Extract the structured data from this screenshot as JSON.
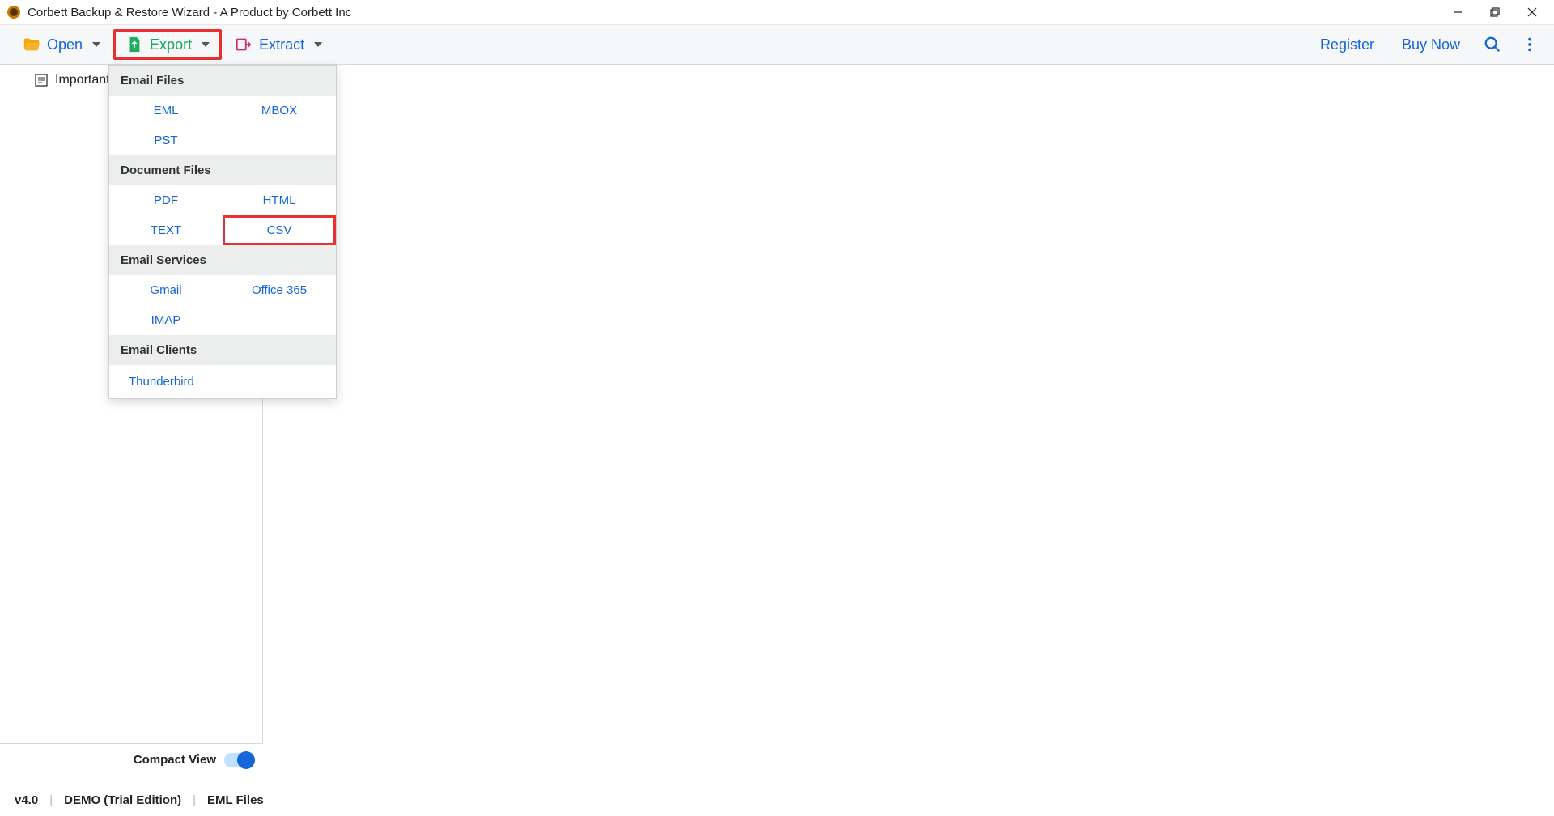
{
  "titlebar": {
    "title": "Corbett Backup & Restore Wizard - A Product by Corbett Inc"
  },
  "toolbar": {
    "open": "Open",
    "export": "Export",
    "extract": "Extract",
    "register": "Register",
    "buy_now": "Buy Now"
  },
  "sidebar": {
    "tree_item": "Important I"
  },
  "compact_view": {
    "label": "Compact View"
  },
  "statusbar": {
    "version": "v4.0",
    "edition": "DEMO (Trial Edition)",
    "filetype": "EML Files"
  },
  "dropdown": {
    "sections": {
      "email_files": {
        "title": "Email Files",
        "items": [
          "EML",
          "MBOX",
          "PST"
        ]
      },
      "document_files": {
        "title": "Document Files",
        "items": [
          "PDF",
          "HTML",
          "TEXT",
          "CSV"
        ]
      },
      "email_services": {
        "title": "Email Services",
        "items": [
          "Gmail",
          "Office 365",
          "IMAP"
        ]
      },
      "email_clients": {
        "title": "Email Clients",
        "items": [
          "Thunderbird"
        ]
      }
    }
  }
}
